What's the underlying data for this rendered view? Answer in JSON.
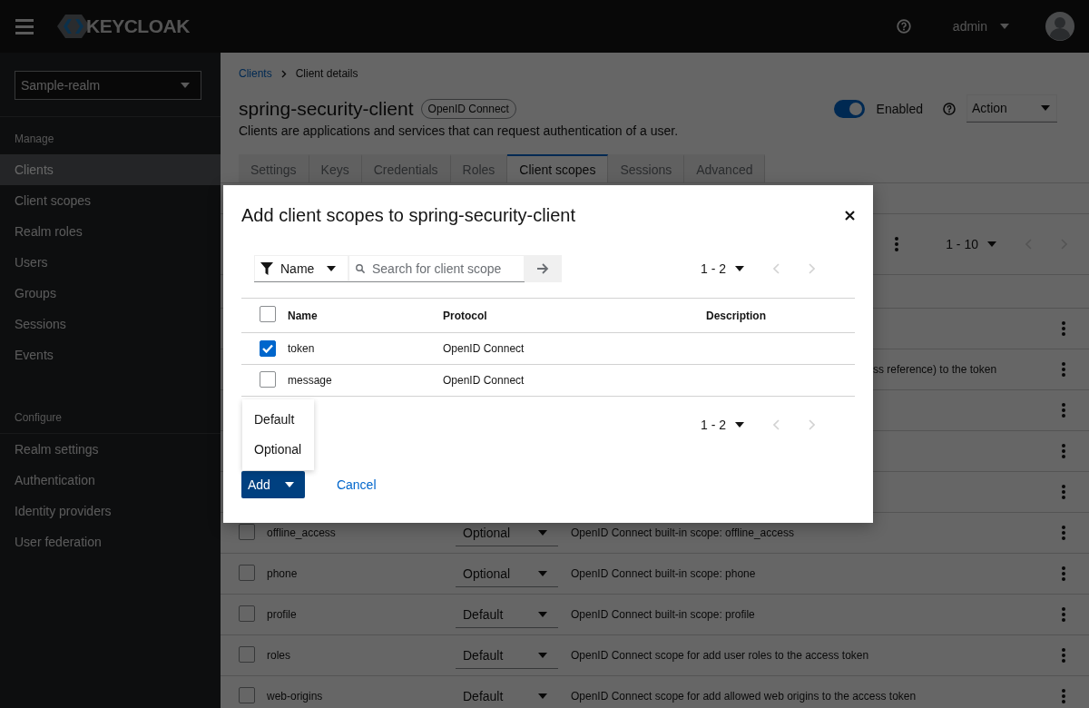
{
  "header": {
    "logo_text": "KEYCLOAK",
    "user": "admin"
  },
  "sidebar": {
    "realm": "Sample-realm",
    "sections": [
      {
        "title": "Manage",
        "items": [
          {
            "label": "Clients",
            "selected": true
          },
          {
            "label": "Client scopes",
            "selected": false
          },
          {
            "label": "Realm roles",
            "selected": false
          },
          {
            "label": "Users",
            "selected": false
          },
          {
            "label": "Groups",
            "selected": false
          },
          {
            "label": "Sessions",
            "selected": false
          },
          {
            "label": "Events",
            "selected": false
          }
        ]
      },
      {
        "title": "Configure",
        "items": [
          {
            "label": "Realm settings",
            "selected": false
          },
          {
            "label": "Authentication",
            "selected": false
          },
          {
            "label": "Identity providers",
            "selected": false
          },
          {
            "label": "User federation",
            "selected": false
          }
        ]
      }
    ]
  },
  "page": {
    "breadcrumb": [
      {
        "label": "Clients",
        "kind": "link"
      },
      {
        "label": "Client details",
        "kind": "current"
      }
    ],
    "title": "spring-security-client",
    "badge": "OpenID Connect",
    "description": "Clients are applications and services that can request authentication of a user.",
    "enabled": true,
    "enabled_label": "Enabled",
    "action": "Action",
    "tabs": [
      {
        "label": "Settings",
        "selected": false
      },
      {
        "label": "Keys",
        "selected": false
      },
      {
        "label": "Credentials",
        "selected": false
      },
      {
        "label": "Roles",
        "selected": false
      },
      {
        "label": "Client scopes",
        "selected": true
      },
      {
        "label": "Sessions",
        "selected": false
      },
      {
        "label": "Advanced",
        "selected": false
      }
    ],
    "pagination": "1 - 10",
    "rows": [
      {
        "kind": "covered"
      },
      {
        "kind": "covered",
        "description": "ss reference) to the token"
      },
      {
        "kind": "covered"
      },
      {
        "kind": "covered"
      },
      {
        "kind": "covered"
      },
      {
        "kind": "row",
        "checked": false,
        "name": "offline_access",
        "type": "Optional",
        "description": "OpenID Connect built-in scope: offline_access"
      },
      {
        "kind": "row",
        "checked": false,
        "name": "phone",
        "type": "Optional",
        "description": "OpenID Connect built-in scope: phone"
      },
      {
        "kind": "row",
        "checked": false,
        "name": "profile",
        "type": "Default",
        "description": "OpenID Connect built-in scope: profile"
      },
      {
        "kind": "row",
        "checked": false,
        "name": "roles",
        "type": "Default",
        "description": "OpenID Connect scope for add user roles to the access token"
      },
      {
        "kind": "row",
        "checked": false,
        "name": "web-origins",
        "type": "Default",
        "description": "OpenID Connect scope for add allowed web origins to the access token"
      }
    ]
  },
  "modal": {
    "title": "Add client scopes to spring-security-client",
    "filter": "Name",
    "search_placeholder": "Search for client scope",
    "pagination": "1 - 2",
    "columns": [
      "Name",
      "Protocol",
      "Description"
    ],
    "select_all_checked": false,
    "rows": [
      {
        "checked": true,
        "name": "token",
        "protocol": "OpenID Connect"
      },
      {
        "checked": false,
        "name": "message",
        "protocol": "OpenID Connect"
      }
    ],
    "bottom_pagination": "1 - 2",
    "add": "Add",
    "menu": [
      "Default",
      "Optional"
    ],
    "cancel": "Cancel"
  }
}
